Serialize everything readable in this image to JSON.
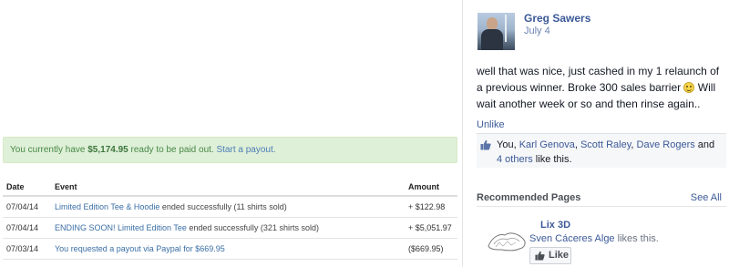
{
  "payout": {
    "prefix": "You currently have ",
    "amount": "$5,174.95",
    "suffix": " ready to be paid out. ",
    "link": "Start a payout."
  },
  "events_table": {
    "headers": {
      "date": "Date",
      "event": "Event",
      "amount": "Amount"
    },
    "rows": [
      {
        "date": "07/04/14",
        "link": "Limited Edition Tee & Hoodie",
        "rest": " ended successfully (11 shirts sold)",
        "amount": "+ $122.98"
      },
      {
        "date": "07/04/14",
        "link": "ENDING SOON! Limited Edition Tee",
        "rest": " ended successfully (321 shirts sold)",
        "amount": "+ $5,051.97"
      },
      {
        "date": "07/03/14",
        "link": "You requested a payout via Paypal for $669.95",
        "rest": "",
        "amount": "($669.95)"
      }
    ]
  },
  "post": {
    "author": "Greg Sawers",
    "date": "July 4",
    "text_before_emoji": "well that was nice, just cashed in my 1 relaunch of a previous winner. Broke 300 sales barrier ",
    "emoji": "smiley",
    "text_after_emoji": " Will wait another week or so and then rinse again..",
    "unlike_label": "Unlike",
    "likes": {
      "prefix": "You, ",
      "names": [
        "Karl Genova",
        "Scott Raley",
        "Dave Rogers"
      ],
      "sep1": ", ",
      "sep2": ", ",
      "and": " and ",
      "others_link": "4 others",
      "suffix": " like this."
    },
    "icons": {
      "like": "thumbs-up-icon"
    }
  },
  "recommended": {
    "title": "Recommended Pages",
    "see_all": "See All",
    "page": {
      "name": "Lix 3D",
      "friend": "Sven Cáceres Alge",
      "friend_suffix": " likes this.",
      "like_button": "Like"
    }
  },
  "colors": {
    "fb_blue": "#3b5998",
    "alert_green_bg": "#dff0d8",
    "link_blue": "#3a6ea5"
  }
}
